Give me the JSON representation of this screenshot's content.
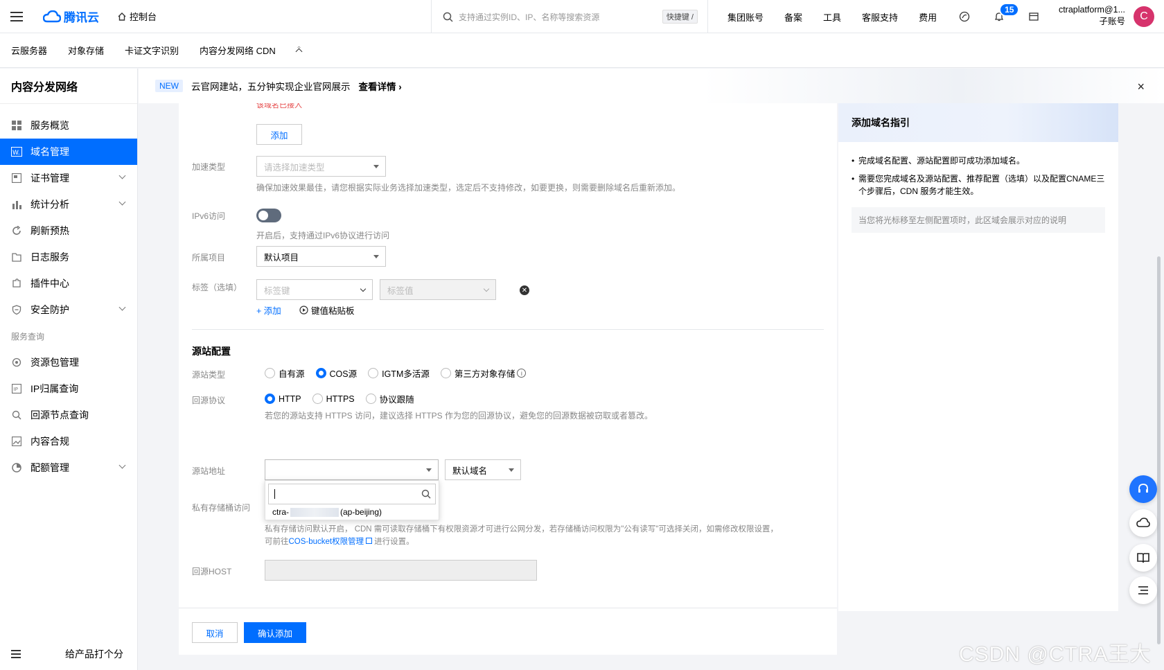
{
  "topbar": {
    "brand": "腾讯云",
    "console": "控制台",
    "search_placeholder": "支持通过实例ID、IP、名称等搜索资源",
    "shortcut": "快捷键 /",
    "nav": [
      "集团账号",
      "备案",
      "工具",
      "客服支持",
      "费用"
    ],
    "notification_count": "15",
    "account_name": "ctraplatform@1...",
    "account_type": "子账号",
    "avatar_letter": "C"
  },
  "subnav": {
    "items": [
      "云服务器",
      "对象存储",
      "卡证文字识别",
      "内容分发网络 CDN"
    ]
  },
  "sidebar": {
    "title": "内容分发网络",
    "items": [
      {
        "label": "服务概览",
        "icon": "grid-icon"
      },
      {
        "label": "域名管理",
        "icon": "domain-icon"
      },
      {
        "label": "证书管理",
        "icon": "certificate-icon"
      },
      {
        "label": "统计分析",
        "icon": "bar-chart-icon"
      },
      {
        "label": "刷新预热",
        "icon": "refresh-icon"
      },
      {
        "label": "日志服务",
        "icon": "folder-icon"
      },
      {
        "label": "插件中心",
        "icon": "plugin-icon"
      },
      {
        "label": "安全防护",
        "icon": "shield-icon"
      }
    ],
    "group_label": "服务查询",
    "query_items": [
      {
        "label": "资源包管理",
        "icon": "package-icon"
      },
      {
        "label": "IP归属查询",
        "icon": "ip-icon"
      },
      {
        "label": "回源节点查询",
        "icon": "search-node-icon"
      },
      {
        "label": "内容合规",
        "icon": "image-icon"
      },
      {
        "label": "配额管理",
        "icon": "pie-icon"
      }
    ],
    "rate_label": "给产品打个分"
  },
  "banner": {
    "tag": "NEW",
    "text": "云官网建站，五分钟实现企业官网展示",
    "link": "查看详情"
  },
  "form": {
    "error_text": "该域名已接入",
    "add_button": "添加",
    "accel_label": "加速类型",
    "accel_placeholder": "请选择加速类型",
    "accel_hint": "确保加速效果最佳，请您根据实际业务选择加速类型，选定后不支持修改，如要更换，则需要删除域名后重新添加。",
    "ipv6_label": "IPv6访问",
    "ipv6_hint": "开启后，支持通过IPv6协议进行访问",
    "project_label": "所属项目",
    "project_value": "默认项目",
    "tag_label": "标签（选填）",
    "tag_key_placeholder": "标签键",
    "tag_value_placeholder": "标签值",
    "tag_add": "+ 添加",
    "kv_paste": "键值粘贴板",
    "origin_section": "源站配置",
    "origin_type_label": "源站类型",
    "origin_types": [
      "自有源",
      "COS源",
      "IGTM多活源",
      "第三方对象存储"
    ],
    "origin_type_selected": "COS源",
    "protocol_label": "回源协议",
    "protocols": [
      "HTTP",
      "HTTPS",
      "协议跟随"
    ],
    "protocol_selected": "HTTP",
    "protocol_hint": "若您的源站支持 HTTPS 访问，建议选择 HTTPS 作为您的回源协议，避免您的回源数据被窃取或者篡改。",
    "origin_addr_label": "源站地址",
    "domain_type_value": "默认域名",
    "dropdown_option_prefix": "ctra-",
    "dropdown_option_suffix": "(ap-beijing)",
    "private_label": "私有存储桶访问",
    "private_hint_1": "私有存储访问默认开启， CDN 需可读取存储桶下有权限资源才可进行公网分发，若存储桶访问权限为\"公有读写\"可选择关闭，如需修改权限设置，",
    "private_hint_2_prefix": "可前往",
    "private_hint_link": "COS-bucket权限管理",
    "private_hint_2_suffix": "进行设置。",
    "host_label": "回源HOST",
    "cancel": "取消",
    "confirm": "确认添加"
  },
  "guide": {
    "title": "添加域名指引",
    "items": [
      "完成域名配置、源站配置即可成功添加域名。",
      "需要您完成域名及源站配置、推荐配置（选填）以及配置CNAME三个步骤后，CDN 服务才能生效。"
    ],
    "note": "当您将光标移至左侧配置项时，此区域会展示对应的说明"
  },
  "watermark": "CSDN @CTRA王大大",
  "colors": {
    "primary": "#006eff",
    "error": "#e54545",
    "avatar": "#d6336c"
  }
}
